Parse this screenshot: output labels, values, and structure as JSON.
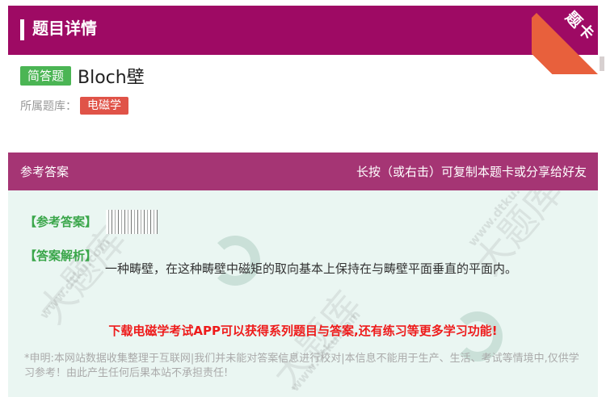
{
  "header": {
    "title": "题目详情"
  },
  "ribbon": {
    "label": "题卡"
  },
  "question": {
    "type_tag": "简答题",
    "title": "Bloch壁"
  },
  "bank": {
    "label": "所属题库：",
    "tag": "电磁学"
  },
  "answer_header": {
    "left": "参考答案",
    "right": "长按（或右击）可复制本题卡或分享给好友"
  },
  "answer": {
    "ref_label": "【参考答案】",
    "analysis_label": "【答案解析】",
    "analysis_text": "一种畴壁，在这种畴壁中磁矩的取向基本上保持在与畴壁平面垂直的平面内。",
    "promo": "下载电磁学考试APP可以获得系列题目与答案,还有练习等更多学习功能!",
    "disclaimer": "*申明:本网站数据收集整理于互联网|我们并未能对答案信息进行校对|本信息不能用于生产、生活、考试等情境中,仅供学习参考！由此产生任何后果本站不承担责任!"
  },
  "watermark": {
    "big": "大题库",
    "small": "www.dtku.com"
  },
  "colors": {
    "header_bg": "#9e0a64",
    "answer_header_bg": "#a53574",
    "answer_body_bg": "#eaf6f2",
    "type_tag_bg": "#4bb554",
    "bank_tag_bg": "#e05348",
    "ribbon_bg": "#e8603c",
    "label_green": "#3aa64a",
    "promo_red": "#ee1b1b"
  }
}
